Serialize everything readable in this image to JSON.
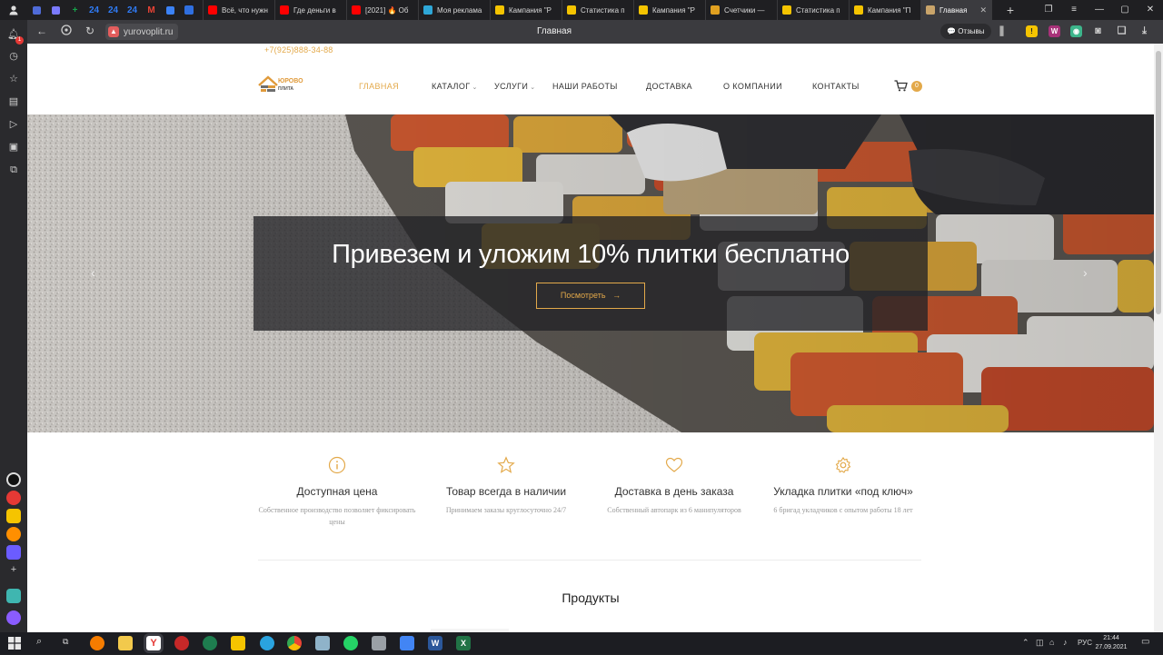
{
  "browser": {
    "pinned": [
      {
        "text": "",
        "color": "#4f6bd8"
      },
      {
        "text": "",
        "color": "#7a7aff"
      },
      {
        "text": "+",
        "color": "#16a34a"
      },
      {
        "text": "24",
        "color": "#2f7bf5"
      },
      {
        "text": "24",
        "color": "#2f7bf5"
      },
      {
        "text": "24",
        "color": "#2f7bf5"
      },
      {
        "text": "M",
        "color": "#ea4335"
      },
      {
        "text": "",
        "color": "#3b82f6"
      }
    ],
    "tabs": [
      {
        "title": "",
        "color": "#2f6fe0",
        "active": false
      },
      {
        "title": "Всё, что нужн",
        "color": "#ff0000",
        "active": false
      },
      {
        "title": "Где деньги в",
        "color": "#ff0000",
        "active": false
      },
      {
        "title": "[2021] 🔥 Об",
        "color": "#ff0000",
        "active": false
      },
      {
        "title": "Моя реклама",
        "color": "#2ea7d8",
        "active": false
      },
      {
        "title": "Кампания \"Р",
        "color": "#f5c400",
        "active": false
      },
      {
        "title": "Статистика п",
        "color": "#f5c400",
        "active": false
      },
      {
        "title": "Кампания \"Р",
        "color": "#f5c400",
        "active": false
      },
      {
        "title": "Счетчики — ",
        "color": "#e0a020",
        "active": false
      },
      {
        "title": "Статистика п",
        "color": "#f5c400",
        "active": false
      },
      {
        "title": "Кампания \"П",
        "color": "#f5c400",
        "active": false
      },
      {
        "title": "Главная",
        "color": "#c9a46a",
        "active": true
      }
    ],
    "new_tab": "+",
    "url": "yurovoplit.ru",
    "page_title": "Главная",
    "reviews_label": "Отзывы",
    "notification_count": "1"
  },
  "site": {
    "phone": "+7(925)888-34-88",
    "logo_line1": "ЮРОВО",
    "logo_line2": "ПЛИТА",
    "nav": [
      {
        "label": "ГЛАВНАЯ",
        "active": true,
        "dropdown": false
      },
      {
        "label": "КАТАЛОГ",
        "active": false,
        "dropdown": true
      },
      {
        "label": "УСЛУГИ",
        "active": false,
        "dropdown": true
      },
      {
        "label": "НАШИ РАБОТЫ",
        "active": false,
        "dropdown": false
      },
      {
        "label": "ДОСТАВКА",
        "active": false,
        "dropdown": false
      },
      {
        "label": "О КОМПАНИИ",
        "active": false,
        "dropdown": false
      },
      {
        "label": "КОНТАКТЫ",
        "active": false,
        "dropdown": false
      }
    ],
    "cart_count": "0",
    "hero": {
      "title": "Привезем и уложим 10% плитки бесплатно",
      "button": "Посмотреть",
      "button_arrow": "→"
    },
    "features": [
      {
        "icon": "info-icon",
        "title": "Доступная цена",
        "subtitle": "Собственное производство позволяет фиксировать цены"
      },
      {
        "icon": "star-icon",
        "title": "Товар всегда в наличии",
        "subtitle": "Принимаем заказы круглосуточно 24/7"
      },
      {
        "icon": "heart-icon",
        "title": "Доставка в день заказа",
        "subtitle": "Собственный автопарк из 6 манипуляторов"
      },
      {
        "icon": "gear-icon",
        "title": "Укладка плитки «под ключ»",
        "subtitle": "6 бригад укладчиков с опытом работы 18 лет"
      }
    ],
    "products_title": "Продукты"
  },
  "taskbar": {
    "language": "РУС",
    "time": "21:44",
    "date": "27.09.2021",
    "accent": "#e3a94a"
  }
}
